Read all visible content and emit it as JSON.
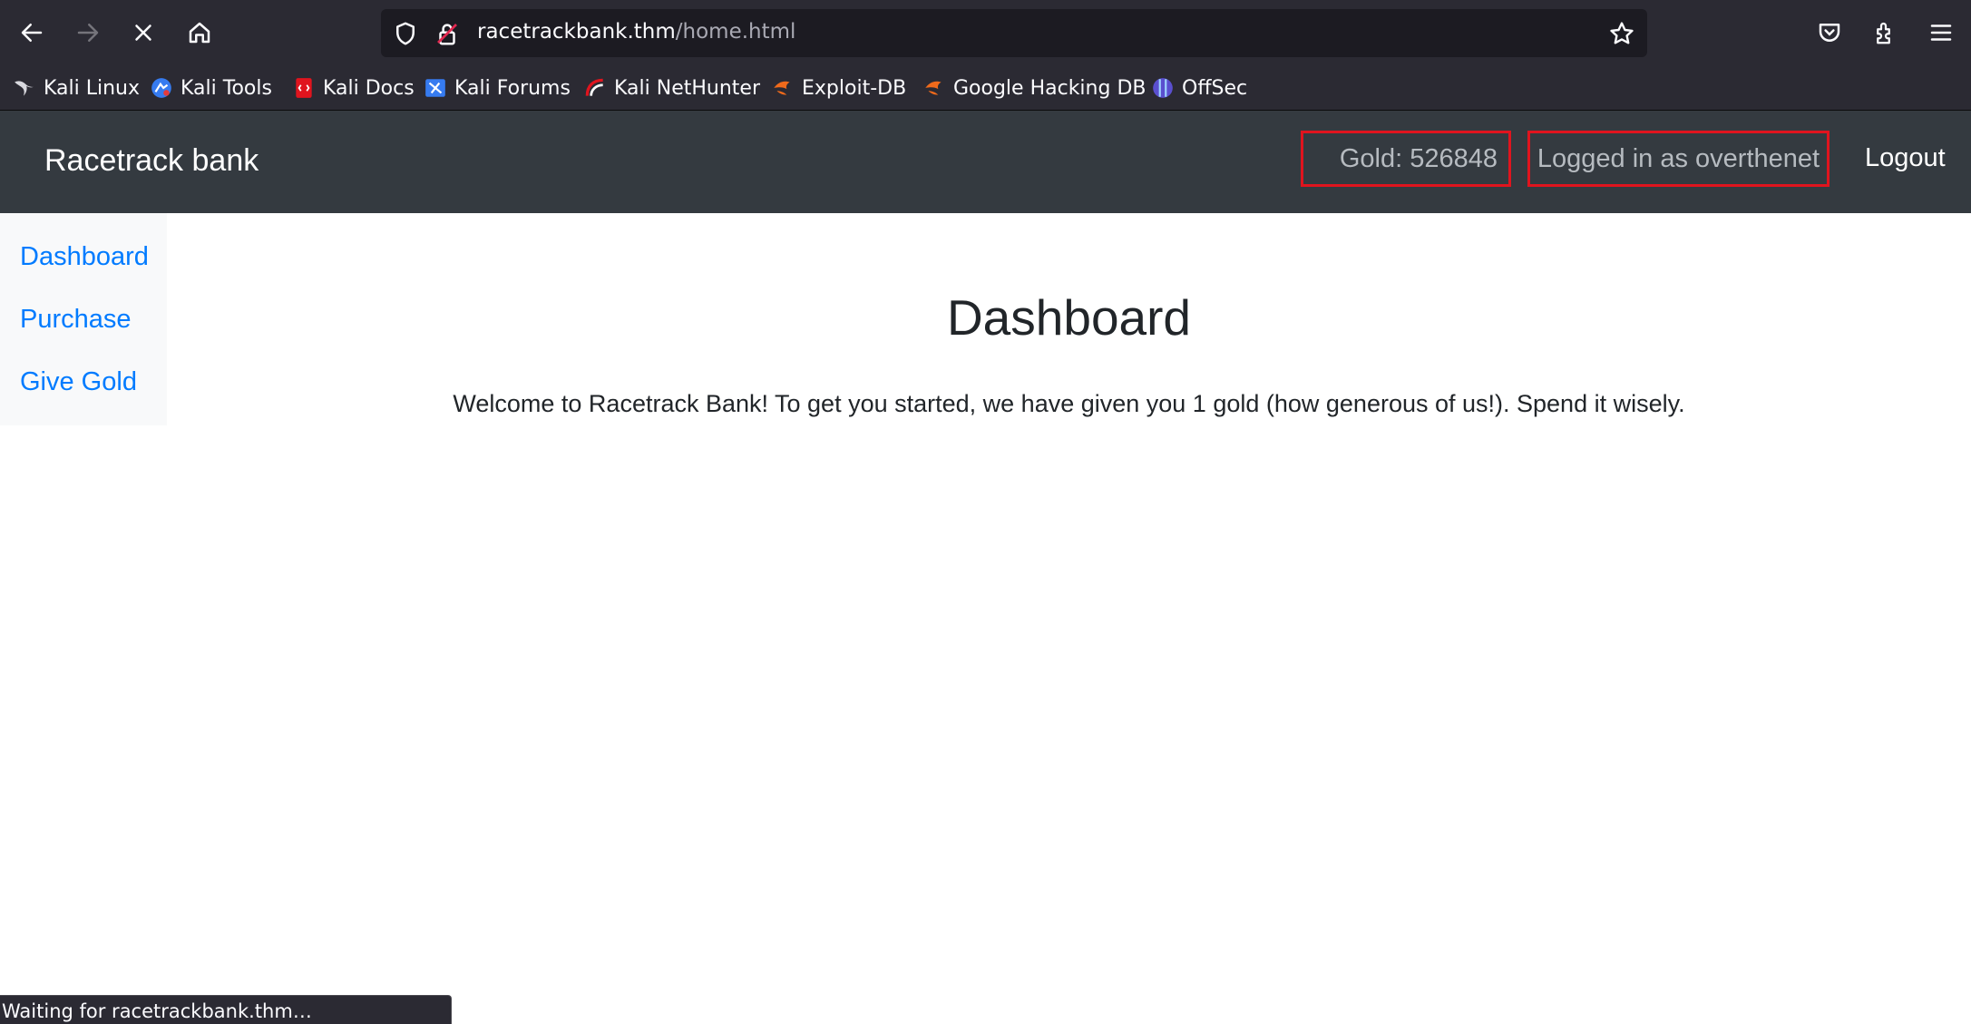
{
  "browser": {
    "url_host": "racetrackbank.thm",
    "url_path": "/home.html",
    "status_text": "Waiting for racetrackbank.thm…",
    "icons": {
      "back": "back-arrow-icon",
      "forward": "forward-arrow-icon",
      "stop": "stop-loading-icon",
      "home": "home-icon",
      "shield": "tracking-protection-shield-icon",
      "lock": "insecure-lock-icon",
      "star": "bookmark-star-icon",
      "pocket": "pocket-icon",
      "extensions": "extensions-icon",
      "menu": "hamburger-menu-icon"
    }
  },
  "bookmarks": [
    {
      "label": "Kali Linux",
      "icon": "kali-dragon-icon"
    },
    {
      "label": "Kali Tools",
      "icon": "kali-tools-icon"
    },
    {
      "label": "Kali Docs",
      "icon": "kali-docs-icon"
    },
    {
      "label": "Kali Forums",
      "icon": "kali-forums-icon"
    },
    {
      "label": "Kali NetHunter",
      "icon": "kali-nethunter-icon"
    },
    {
      "label": "Exploit-DB",
      "icon": "exploit-db-icon"
    },
    {
      "label": "Google Hacking DB",
      "icon": "google-hacking-db-icon"
    },
    {
      "label": "OffSec",
      "icon": "offsec-icon"
    }
  ],
  "site": {
    "brand": "Racetrack bank",
    "gold": "Gold: 526848",
    "user": "Logged in as overthenet",
    "logout": "Logout",
    "sidebar": [
      "Dashboard",
      "Purchase",
      "Give Gold"
    ],
    "title": "Dashboard",
    "welcome": "Welcome to Racetrack Bank! To get you started, we have given you 1 gold (how generous of us!). Spend it wisely."
  },
  "colors": {
    "navbar": "#343a40",
    "link": "#007bff",
    "highlight_box": "#e0141e",
    "browser_chrome": "#2b2a33"
  }
}
